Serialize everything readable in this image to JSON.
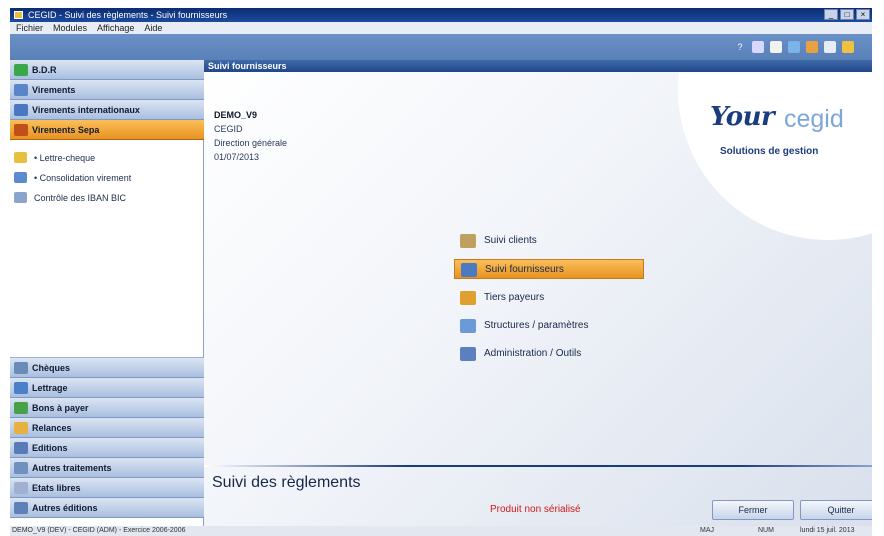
{
  "window": {
    "title": "CEGID - Suivi des règlements - Suivi fournisseurs"
  },
  "menu": [
    "Fichier",
    "Modules",
    "Affichage",
    "Aide"
  ],
  "toolbar": {
    "tool_icons": [
      "help-icon",
      "edit-icon",
      "calendar-icon",
      "mail-icon",
      "user-icon",
      "print-icon",
      "folder-icon"
    ]
  },
  "sidebar": {
    "top_header": "B.D.R",
    "sections": [
      "Virements",
      "Virements internationaux",
      "Virements Sepa"
    ],
    "active_section": "Virements Sepa",
    "sub_items": [
      "• Lettre-cheque",
      "• Consolidation virement",
      "Contrôle des IBAN BIC"
    ],
    "bottom_sections": [
      "Chèques",
      "Lettrage",
      "Bons à payer",
      "Relances",
      "Editions",
      "Autres traitements",
      "Etats libres",
      "Autres éditions"
    ]
  },
  "main": {
    "header": "Suivi fournisseurs",
    "company": "DEMO_V9",
    "info_lines": [
      "CEGID",
      "Direction générale",
      "01/07/2013"
    ],
    "logo": {
      "brand_bold": "Your",
      "brand_light": "cegid",
      "tagline": "Solutions de gestion"
    },
    "actions": [
      {
        "label": "Suivi clients",
        "icon": "clients-icon"
      },
      {
        "label": "Suivi fournisseurs",
        "icon": "suppliers-icon",
        "active": true
      },
      {
        "label": "Tiers payeurs",
        "icon": "third-party-icon"
      },
      {
        "label": "Structures / paramètres",
        "icon": "structure-icon"
      },
      {
        "label": "Administration / Outils",
        "icon": "admin-tools-icon"
      }
    ],
    "bottom_title": "Suivi des règlements",
    "notice": "Produit non sérialisé",
    "buttons": {
      "close": "Fermer",
      "quit": "Quitter"
    }
  },
  "status": {
    "left": "DEMO_V9 (DEV) - CEGID (ADM) - Exercice 2006-2006",
    "user": "MAJ",
    "caps": "NUM",
    "date": "lundi 15 juil. 2013"
  }
}
